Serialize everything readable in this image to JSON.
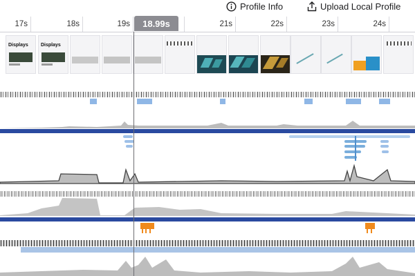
{
  "toolbar": {
    "profile_info_label": "Profile Info",
    "upload_label": "Upload Local Profile",
    "info_icon": "info-circle-icon",
    "upload_icon": "upload-icon"
  },
  "timeline": {
    "ticks": [
      "17s",
      "18s",
      "19s",
      "21s",
      "22s",
      "23s",
      "24s"
    ],
    "cursor_label": "18.99s"
  },
  "screenshots": {
    "caption_a": "Displays"
  },
  "colors": {
    "accent_blue": "#2a4aa0",
    "orange": "#f08a1c",
    "light_blue": "#8fb7e6",
    "track_gray": "#8a8a8a"
  }
}
